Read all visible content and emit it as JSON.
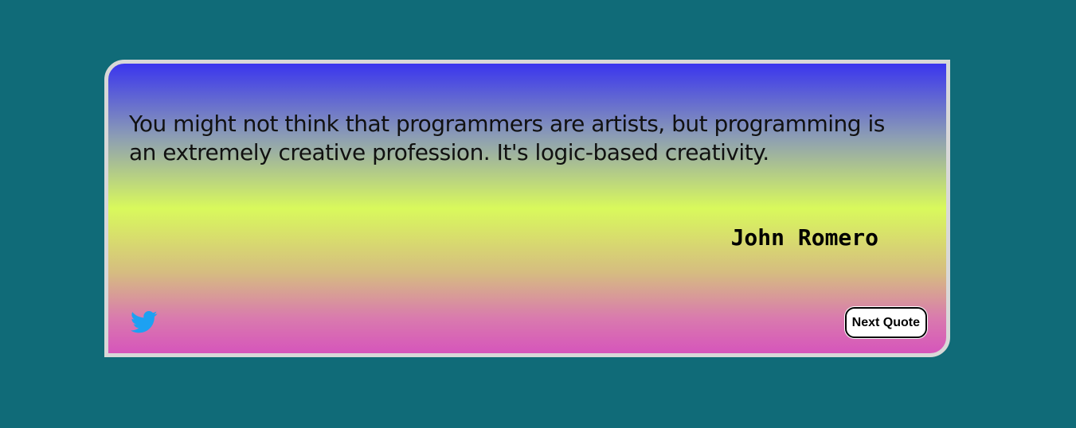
{
  "colors": {
    "background": "#106b78",
    "card_border": "#d8d8d8",
    "gradient_top": "#3a35ee",
    "gradient_middle": "#d9f95c",
    "gradient_bottom": "#d655bb",
    "twitter_blue": "#1da1f2"
  },
  "quote": {
    "text": "You might not think that programmers are artists, but programming is an extremely creative profession. It's logic-based creativity.",
    "author": "John Romero"
  },
  "actions": {
    "tweet_icon": "twitter-bird-icon",
    "next_label": "Next Quote"
  }
}
